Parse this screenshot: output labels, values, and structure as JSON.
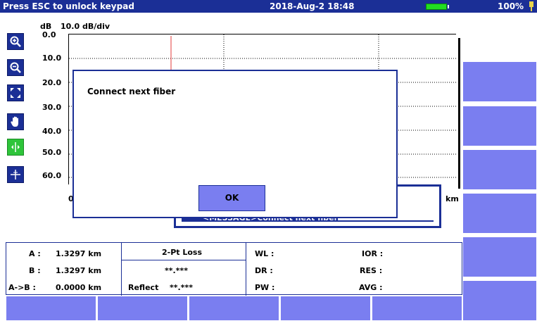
{
  "status": {
    "left_text": "Press ESC to unlock keypad",
    "datetime": "2018-Aug-2 18:48",
    "battery_pct": "100%",
    "battery_color": "#22dd22"
  },
  "tools": [
    "zoom-in",
    "zoom-out",
    "fit",
    "pan",
    "cursor",
    "marker"
  ],
  "chart": {
    "y_unit": "dB",
    "scale": "10.0 dB/div",
    "y_ticks": [
      "0.0",
      "10.0",
      "20.0",
      "30.0",
      "40.0",
      "50.0",
      "60.0"
    ],
    "x_unit": "km",
    "x_first_partial": "0"
  },
  "chart_data": {
    "type": "line",
    "title": "",
    "ylabel": "dB",
    "ylim": [
      0,
      60
    ],
    "cursor_color": "#e33b3b"
  },
  "dialog": {
    "message": "Connect next fiber",
    "ok_label": "OK"
  },
  "background_window": {
    "text": "<MESSAGE>Connect next fiber"
  },
  "info": {
    "a_label": "A :",
    "a_value": "1.3297 km",
    "b_label": "B :",
    "b_value": "1.3297 km",
    "ab_label": "A->B :",
    "ab_value": "0.0000 km",
    "loss_title": "2-Pt Loss",
    "loss_value": "**.***",
    "reflect_label": "Reflect",
    "reflect_value": "**.***",
    "wl_label": "WL :",
    "dr_label": "DR :",
    "pw_label": "PW :",
    "ior_label": "IOR :",
    "res_label": "RES :",
    "avg_label": "AVG :"
  },
  "colors": {
    "primary_blue": "#1b2f96",
    "function_key": "#7a7ef0",
    "active_green": "#2ec43a"
  }
}
